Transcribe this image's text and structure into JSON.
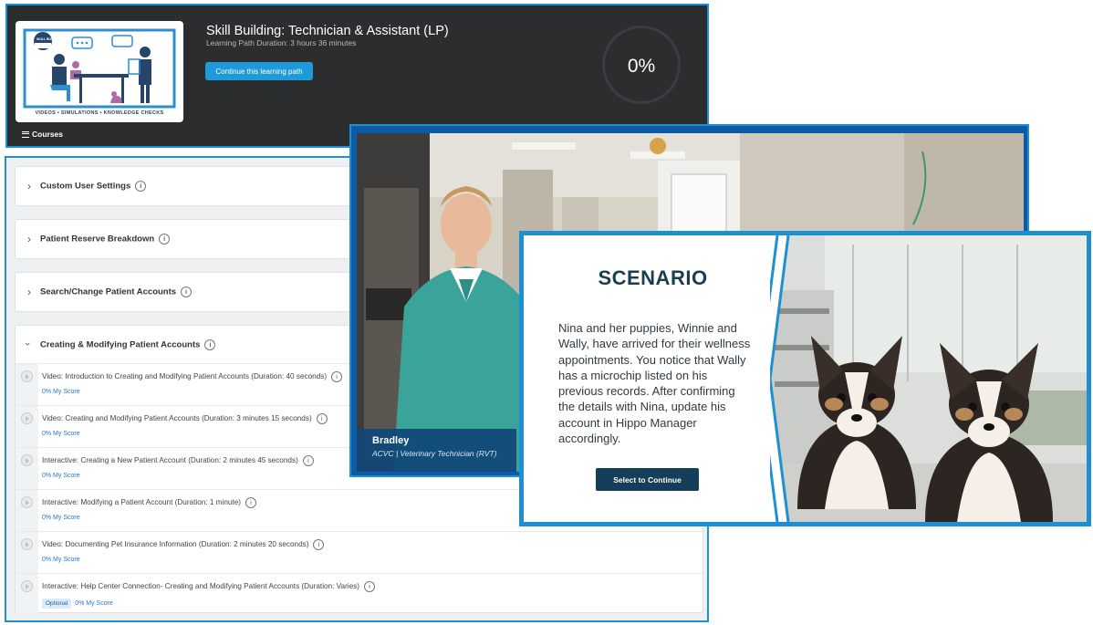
{
  "learning_path": {
    "title": "Skill Building: Technician & Assistant (LP)",
    "duration": "Learning Path Duration: 3 hours 36 minutes",
    "continue_label": "Continue this learning path",
    "progress": "0%",
    "courses_label": "Courses",
    "thumbnail_caption": "VIDEOS • SIMULATIONS • KNOWLEDGE CHECKS",
    "thumbnail_badge": "SKILL BUILDING"
  },
  "sections": [
    {
      "title": "Custom User Settings"
    },
    {
      "title": "Patient Reserve Breakdown"
    },
    {
      "title": "Search/Change Patient Accounts"
    },
    {
      "title": "Creating & Modifying Patient Accounts"
    }
  ],
  "items": [
    {
      "title": "Video: Introduction to Creating and Modifying Patient Accounts (Duration: 40 seconds)",
      "score": "0% My Score"
    },
    {
      "title": "Video: Creating and Modifying Patient Accounts (Duration: 3 minutes 15 seconds)",
      "score": "0% My Score"
    },
    {
      "title": "Interactive: Creating a New Patient Account (Duration: 2 minutes 45 seconds)",
      "score": "0% My Score"
    },
    {
      "title": "Interactive: Modifying a Patient Account (Duration: 1 minute)",
      "score": "0% My Score"
    },
    {
      "title": "Video: Documenting Pet Insurance Information (Duration: 2 minutes 20 seconds)",
      "score": "0% My Score"
    },
    {
      "title": "Interactive: Help Center Connection- Creating and Modifying Patient Accounts (Duration: Varies)",
      "score": "0% My Score",
      "badge": "Optional"
    }
  ],
  "video": {
    "presenter_name": "Bradley",
    "presenter_role": "ACVC  |  Veterinary Technician (RVT)"
  },
  "scenario": {
    "title": "SCENARIO",
    "text": "Nina and her puppies, Winnie and Wally, have arrived for their wellness appointments. You notice that Wally has a microchip listed on his previous records. After confirming the details with Nina, update his account in Hippo Manager accordingly.",
    "button_label": "Select to Continue"
  },
  "colors": {
    "accent": "#1e8fd0",
    "header_bg": "#2c2d2f",
    "scenario_title": "#1a3d52",
    "scenario_button": "#143e5a"
  }
}
